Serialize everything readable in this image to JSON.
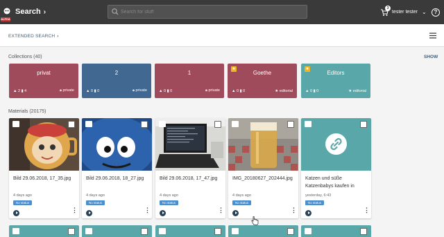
{
  "header": {
    "logo_badge": "ALPHA",
    "title": "Search",
    "search_placeholder": "Search for stuff",
    "cart_count": "3",
    "user_name": "tester tester",
    "help_glyph": "?"
  },
  "subbar": {
    "extended_search": "EXTENDED SEARCH"
  },
  "collections": {
    "heading": "Collections (40)",
    "show_label": "SHOW",
    "items": [
      {
        "name": "privat",
        "children": "2",
        "materials": "4",
        "scope": "private",
        "color": "#a04b5c",
        "starred": false
      },
      {
        "name": "2",
        "children": "0",
        "materials": "0",
        "scope": "private",
        "color": "#416890",
        "starred": false
      },
      {
        "name": "1",
        "children": "0",
        "materials": "0",
        "scope": "private",
        "color": "#a04b5c",
        "starred": false
      },
      {
        "name": "Goethe",
        "children": "0",
        "materials": "0",
        "scope": "editorial",
        "color": "#a04b5c",
        "starred": true
      },
      {
        "name": "Editors",
        "children": "0",
        "materials": "0",
        "scope": "editorial",
        "color": "#5aa7a9",
        "starred": true
      }
    ]
  },
  "materials": {
    "heading": "Materials (20175)",
    "items": [
      {
        "title": "Bild 29.06.2018, 17_35.jpg",
        "date": "4 days ago",
        "status": "No status",
        "type": "image-icon"
      },
      {
        "title": "Bild 29.06.2018, 18_27.jpg",
        "date": "4 days ago",
        "status": "No status",
        "type": "image-icon"
      },
      {
        "title": "Bild 29.06.2018, 17_47.jpg",
        "date": "4 days ago",
        "status": "No status",
        "type": "image-icon"
      },
      {
        "title": "IMG_20180627_202444.jpg",
        "date": "4 days ago",
        "status": "No status",
        "type": "image-icon"
      },
      {
        "title": "Katzen und süße Katzenbabys kaufen in",
        "date": "yesterday, 6:43",
        "status": "No status",
        "type": "link-icon"
      }
    ]
  },
  "colors": {
    "topbar": "#3a3a3a",
    "accent": "#3a5f7c",
    "status": "#4a8fd0",
    "teal": "#5aa7a9"
  }
}
